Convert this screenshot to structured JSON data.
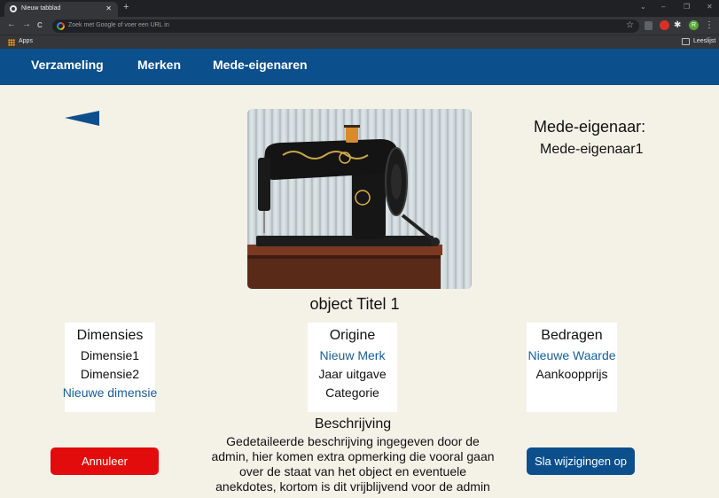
{
  "browser": {
    "tab_title": "Nieuw tabblad",
    "tab_close": "✕",
    "new_tab": "+",
    "back": "←",
    "forward": "→",
    "reload": "C",
    "omnibox_placeholder": "Zoek met Google of voer een URL in",
    "bookmark_star": "☆",
    "profile_initial": "R",
    "menu_dots": "⋮",
    "apps_label": "Apps",
    "reading_list_label": "Leeslijst",
    "win_minimize": "–",
    "win_restore": "❐",
    "win_close": "✕",
    "collapse": "⌄"
  },
  "nav": {
    "items": [
      "Verzameling",
      "Merken",
      "Mede-eigenaren"
    ]
  },
  "object": {
    "title": "object Titel 1",
    "coowner_label": "Mede-eigenaar:",
    "coowner_name": "Mede-eigenaar1"
  },
  "dimensions": {
    "heading": "Dimensies",
    "items": [
      "Dimensie1",
      "Dimensie2"
    ],
    "add_link": "Nieuwe dimensie"
  },
  "origin": {
    "heading": "Origine",
    "new_brand_link": "Nieuw Merk",
    "year": "Jaar uitgave",
    "category": "Categorie"
  },
  "amounts": {
    "heading": "Bedragen",
    "new_value_link": "Nieuwe Waarde",
    "purchase_price": "Aankoopprijs"
  },
  "description": {
    "heading": "Beschrijving",
    "text": "Gedetaileerde beschrijving ingegeven door de admin, hier komen extra opmerking die vooral gaan over de staat van het object en eventuele anekdotes, kortom is dit vrijblijvend voor de admin"
  },
  "actions": {
    "cancel_label": "Annuleer",
    "save_label": "Sla wijzigingen op"
  },
  "colors": {
    "nav_bg": "#0b4f8c",
    "page_bg": "#f4f1e7",
    "link": "#175c99",
    "cancel": "#e30c0c",
    "save": "#0b4f8c"
  }
}
